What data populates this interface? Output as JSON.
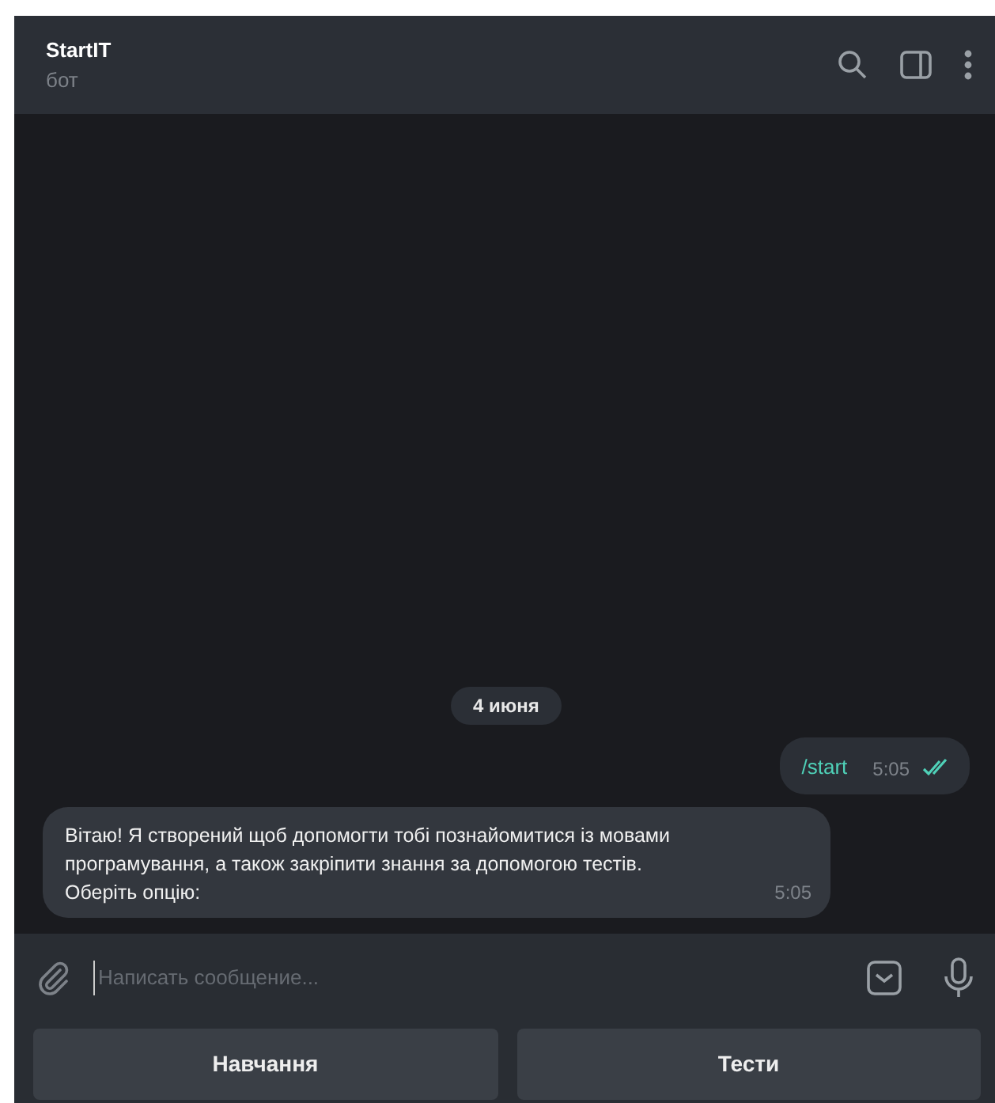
{
  "header": {
    "title": "StartIT",
    "subtitle": "бот"
  },
  "date_badge": "4 июня",
  "messages": [
    {
      "kind": "outgoing",
      "text": "/start",
      "time": "5:05",
      "read": true
    },
    {
      "kind": "incoming",
      "text": "Вітаю! Я створений щоб допомогти тобі познайомитися із мовами програмування, а також закріпити знання за допомогою тестів. Оберіть опцію:",
      "time": "5:05"
    }
  ],
  "composer": {
    "placeholder": "Написать сообщение..."
  },
  "keyboard": [
    "Навчання",
    "Тести"
  ]
}
